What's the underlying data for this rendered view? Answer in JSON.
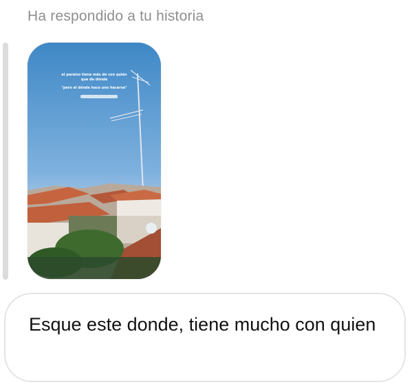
{
  "reply": {
    "header": "Ha respondido a tu historia"
  },
  "story": {
    "caption_line1": "el paraíso tiene más de con quién",
    "caption_line2": "que de dónde",
    "caption_line3": "\"pero el dónde hace uno hacerse\""
  },
  "message": {
    "text": "Esque este donde, tiene mucho con quien"
  },
  "colors": {
    "sky": "#4a8fca",
    "bubble_border": "#e4e4e4",
    "header_text": "#8e8e8e"
  }
}
